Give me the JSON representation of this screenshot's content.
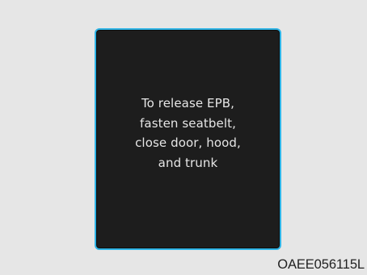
{
  "display": {
    "message_lines": [
      "To release EPB,",
      "fasten seatbelt,",
      "close door, hood,",
      "and trunk"
    ],
    "border_color": "#2fb4e6",
    "background_color": "#1d1d1d",
    "text_color": "#e6e6e6"
  },
  "figure_code": "OAEE056115L"
}
